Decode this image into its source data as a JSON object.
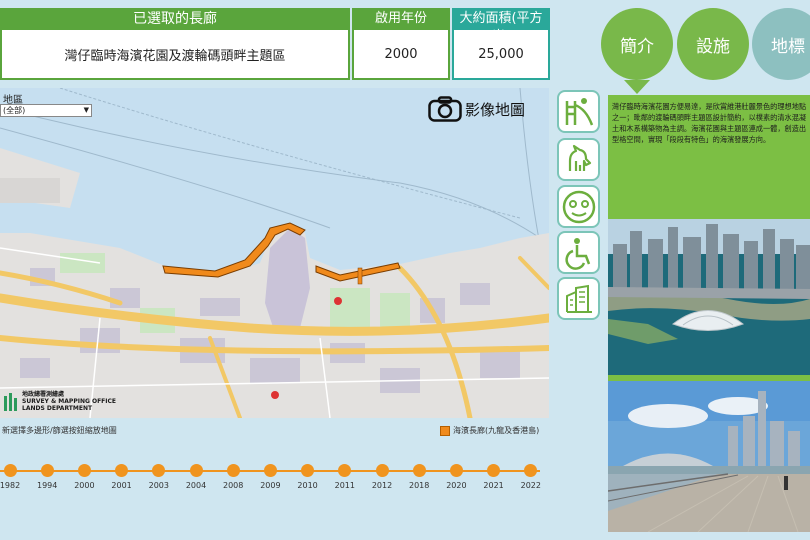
{
  "header": {
    "corridor_title": "已選取的長廊",
    "corridor_value": "灣仔臨時海濱花園及渡輪碼頭畔主題區",
    "year_title": "啟用年份",
    "year_value": "2000",
    "area_title": "大約面積(平方米)",
    "area_value": "25,000"
  },
  "tabs": [
    {
      "label": "簡介"
    },
    {
      "label": "設施"
    },
    {
      "label": "地標"
    }
  ],
  "map": {
    "district_label": "地區",
    "district_value": "(全部)",
    "photo_map_label": "影像地圖",
    "logo_line1": "地政總署測繪處",
    "logo_line2": "SURVEY & MAPPING OFFICE",
    "logo_line3": "LANDS DEPARTMENT"
  },
  "hint": "新選擇多邊形/篩選按鈕縮放地圖",
  "legend": {
    "label": "海濱長廊(九龍及香港島)",
    "color": "#f08a1c"
  },
  "timeline": [
    "1982",
    "1994",
    "2000",
    "2001",
    "2003",
    "2004",
    "2008",
    "2009",
    "2010",
    "2011",
    "2012",
    "2018",
    "2020",
    "2021",
    "2022"
  ],
  "side_icons": [
    "playground-icon",
    "pet-friendly-icon",
    "face-icon",
    "accessibility-icon",
    "building-icon"
  ],
  "info": {
    "intro_text": "灣仔臨時海濱花園方便易達，是欣賞維港壯麗景色的理想地點之一；毗鄰的渡輪碼頭畔主題區設計簡約，以樸素的清水混凝土和木系構築物為主調。海濱花園與主題區連成一體，創造出型格空間，實現「段段有特色」的海濱發展方向。"
  },
  "colors": {
    "green": "#79b84a",
    "teal": "#2aa89a",
    "orange": "#f0941e"
  }
}
